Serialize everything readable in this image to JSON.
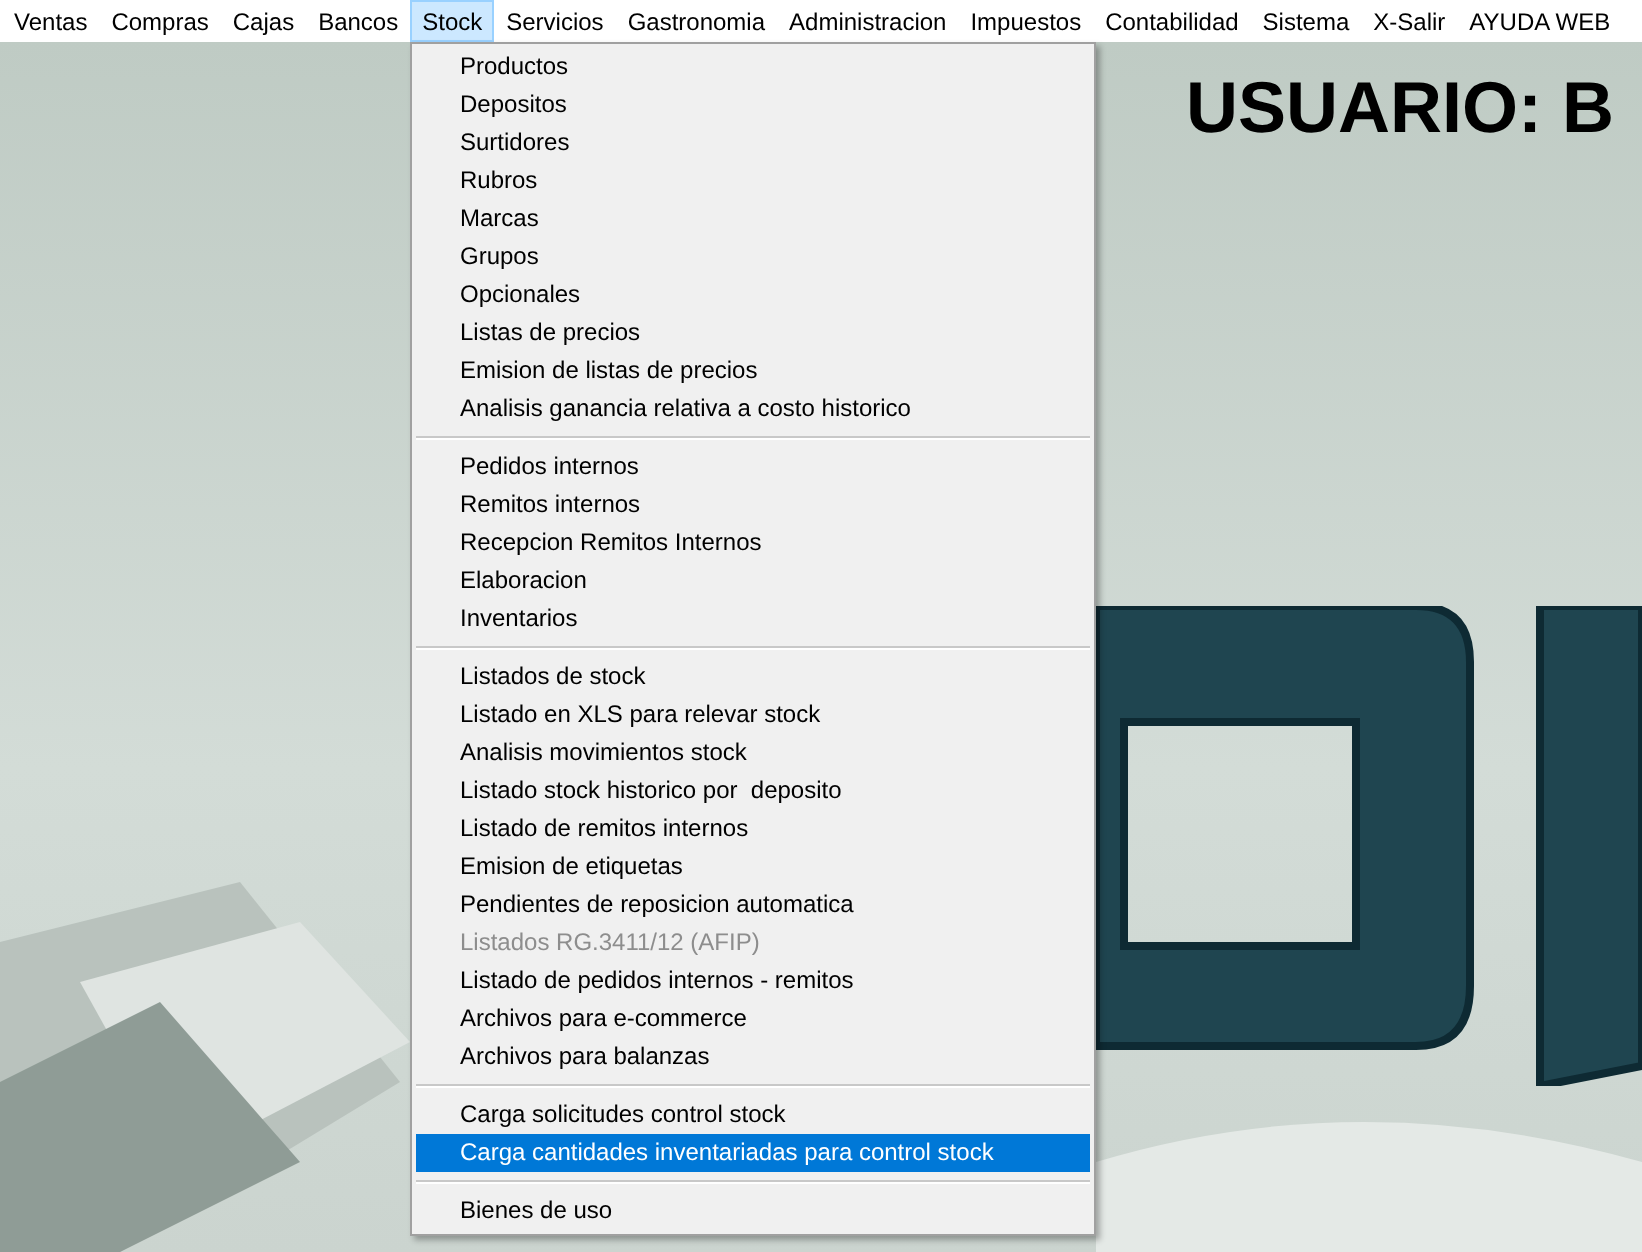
{
  "menu_bar": [
    {
      "label": "Ventas",
      "selected": false
    },
    {
      "label": "Compras",
      "selected": false
    },
    {
      "label": "Cajas",
      "selected": false
    },
    {
      "label": "Bancos",
      "selected": false
    },
    {
      "label": "Stock",
      "selected": true
    },
    {
      "label": "Servicios",
      "selected": false
    },
    {
      "label": "Gastronomia",
      "selected": false
    },
    {
      "label": "Administracion",
      "selected": false
    },
    {
      "label": "Impuestos",
      "selected": false
    },
    {
      "label": "Contabilidad",
      "selected": false
    },
    {
      "label": "Sistema",
      "selected": false
    },
    {
      "label": "X-Salir",
      "selected": false
    },
    {
      "label": "AYUDA WEB",
      "selected": false
    }
  ],
  "user_heading": "USUARIO: B",
  "dropdown": {
    "groups": [
      {
        "items": [
          {
            "label": "Productos",
            "selected": false,
            "disabled": false
          },
          {
            "label": "Depositos",
            "selected": false,
            "disabled": false
          },
          {
            "label": "Surtidores",
            "selected": false,
            "disabled": false
          },
          {
            "label": "Rubros",
            "selected": false,
            "disabled": false
          },
          {
            "label": "Marcas",
            "selected": false,
            "disabled": false
          },
          {
            "label": "Grupos",
            "selected": false,
            "disabled": false
          },
          {
            "label": "Opcionales",
            "selected": false,
            "disabled": false
          },
          {
            "label": "Listas de precios",
            "selected": false,
            "disabled": false
          },
          {
            "label": "Emision de listas de precios",
            "selected": false,
            "disabled": false
          },
          {
            "label": "Analisis ganancia relativa a costo historico",
            "selected": false,
            "disabled": false
          }
        ]
      },
      {
        "items": [
          {
            "label": "Pedidos internos",
            "selected": false,
            "disabled": false
          },
          {
            "label": "Remitos internos",
            "selected": false,
            "disabled": false
          },
          {
            "label": "Recepcion Remitos Internos",
            "selected": false,
            "disabled": false
          },
          {
            "label": "Elaboracion",
            "selected": false,
            "disabled": false
          },
          {
            "label": "Inventarios",
            "selected": false,
            "disabled": false
          }
        ]
      },
      {
        "items": [
          {
            "label": "Listados de stock",
            "selected": false,
            "disabled": false
          },
          {
            "label": "Listado en XLS para relevar stock",
            "selected": false,
            "disabled": false
          },
          {
            "label": "Analisis movimientos stock",
            "selected": false,
            "disabled": false
          },
          {
            "label": "Listado stock historico por  deposito",
            "selected": false,
            "disabled": false
          },
          {
            "label": "Listado de remitos internos",
            "selected": false,
            "disabled": false
          },
          {
            "label": "Emision de etiquetas",
            "selected": false,
            "disabled": false
          },
          {
            "label": "Pendientes de reposicion automatica",
            "selected": false,
            "disabled": false
          },
          {
            "label": "Listados RG.3411/12 (AFIP)",
            "selected": false,
            "disabled": true
          },
          {
            "label": "Listado de pedidos internos - remitos",
            "selected": false,
            "disabled": false
          },
          {
            "label": "Archivos para e-commerce",
            "selected": false,
            "disabled": false
          },
          {
            "label": "Archivos para balanzas",
            "selected": false,
            "disabled": false
          }
        ]
      },
      {
        "items": [
          {
            "label": "Carga solicitudes control stock",
            "selected": false,
            "disabled": false
          },
          {
            "label": "Carga cantidades inventariadas para control stock",
            "selected": true,
            "disabled": false
          }
        ]
      },
      {
        "items": [
          {
            "label": "Bienes de uso",
            "selected": false,
            "disabled": false
          }
        ]
      }
    ]
  }
}
